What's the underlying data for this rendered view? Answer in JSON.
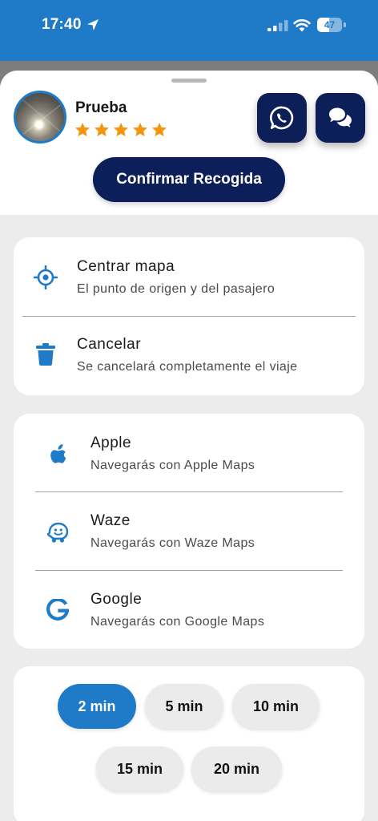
{
  "status_bar": {
    "time": "17:40",
    "battery_level": "47",
    "battery_fraction": 0.47,
    "icons": [
      "location-arrow-icon",
      "cellular-signal-icon",
      "wifi-icon",
      "battery-icon"
    ]
  },
  "driver": {
    "name": "Prueba",
    "rating": 5,
    "rating_max": 5
  },
  "header_buttons": {
    "whatsapp_icon": "whatsapp-icon",
    "chat_icon": "chat-bubbles-icon"
  },
  "confirm_label": "Confirmar Recogida",
  "actions": [
    {
      "icon": "crosshair-icon",
      "title": "Centrar mapa",
      "subtitle": "El punto de origen y del pasajero"
    },
    {
      "icon": "trash-icon",
      "title": "Cancelar",
      "subtitle": "Se cancelará completamente el viaje"
    }
  ],
  "navigation": [
    {
      "icon": "apple-icon",
      "title": "Apple",
      "subtitle": "Navegarás con Apple Maps"
    },
    {
      "icon": "waze-icon",
      "title": "Waze",
      "subtitle": "Navegarás con Waze Maps"
    },
    {
      "icon": "google-icon",
      "title": "Google",
      "subtitle": "Navegarás con Google Maps"
    }
  ],
  "time_options": [
    {
      "label": "2 min",
      "selected": true
    },
    {
      "label": "5 min",
      "selected": false
    },
    {
      "label": "10 min",
      "selected": false
    },
    {
      "label": "15 min",
      "selected": false
    },
    {
      "label": "20 min",
      "selected": false
    }
  ],
  "colors": {
    "accent_blue": "#1f7ac7",
    "navy": "#0c1f59",
    "star": "#f5950f",
    "background": "#ececec"
  }
}
